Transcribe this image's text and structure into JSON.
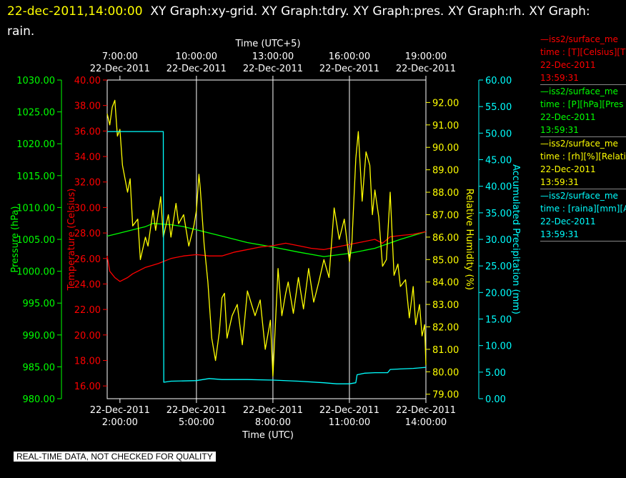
{
  "header": {
    "timestamp": "22-dec-2011,14:00:00",
    "titles": "XY Graph:xy-grid.  XY Graph:tdry.  XY Graph:pres.  XY Graph:rh.  XY Graph: rain."
  },
  "footer": {
    "quality_notice": "REAL-TIME DATA, NOT CHECKED FOR QUALITY"
  },
  "colors": {
    "background": "#000000",
    "frame": "#ffffff",
    "pressure": "#00ff00",
    "temperature": "#ff0000",
    "humidity": "#ffff00",
    "precip": "#00ffff"
  },
  "legend": [
    {
      "color": "#ff0000",
      "line1": "—iss2/surface_me",
      "line2": "time : [T][Celsius][T",
      "date": "22-Dec-2011",
      "time": "13:59:31"
    },
    {
      "color": "#00ff00",
      "line1": "—iss2/surface_me",
      "line2": "time : [P][hPa][Pres",
      "date": "22-Dec-2011",
      "time": "13:59:31"
    },
    {
      "color": "#ffff00",
      "line1": "—iss2/surface_me",
      "line2": "time : [rh][%][Relati",
      "date": "22-Dec-2011",
      "time": "13:59:31"
    },
    {
      "color": "#00ffff",
      "line1": "—iss2/surface_me",
      "line2": "time : [raina][mm][A",
      "date": "22-Dec-2011",
      "time": "13:59:31"
    }
  ],
  "chart_data": {
    "type": "line",
    "xlabel_top": "Time (UTC+5)",
    "xlabel_bottom": "Time (UTC)",
    "x_range_hours_utc": [
      1.5,
      14.0
    ],
    "x_ticks_bottom": [
      {
        "hour": 2,
        "date": "22-Dec-2011",
        "time": "2:00:00"
      },
      {
        "hour": 5,
        "date": "22-Dec-2011",
        "time": "5:00:00"
      },
      {
        "hour": 8,
        "date": "22-Dec-2011",
        "time": "8:00:00"
      },
      {
        "hour": 11,
        "date": "22-Dec-2011",
        "time": "11:00:00"
      },
      {
        "hour": 14,
        "date": "22-Dec-2011",
        "time": "14:00:00"
      }
    ],
    "x_ticks_top": [
      {
        "hour": 2,
        "time": "7:00:00",
        "date": "22-Dec-2011"
      },
      {
        "hour": 5,
        "time": "10:00:00",
        "date": "22-Dec-2011"
      },
      {
        "hour": 8,
        "time": "13:00:00",
        "date": "22-Dec-2011"
      },
      {
        "hour": 11,
        "time": "16:00:00",
        "date": "22-Dec-2011"
      },
      {
        "hour": 14,
        "time": "19:00:00",
        "date": "22-Dec-2011"
      }
    ],
    "grid_vertical_hours": [
      5,
      8,
      11
    ],
    "axes": {
      "pressure": {
        "label": "Pressure (hPa)",
        "range": [
          980,
          1030
        ],
        "ticks": [
          "980.00",
          "985.00",
          "990.00",
          "995.00",
          "1000.00",
          "1005.00",
          "1010.00",
          "1015.00",
          "1020.00",
          "1025.00",
          "1030.00"
        ]
      },
      "temperature": {
        "label": "Temperature (Celsius)",
        "range": [
          15,
          40
        ],
        "ticks": [
          "16.00",
          "18.00",
          "20.00",
          "22.00",
          "24.00",
          "26.00",
          "28.00",
          "30.00",
          "32.00",
          "34.00",
          "36.00",
          "38.00",
          "40.00"
        ]
      },
      "humidity": {
        "label": "Relative Humidity (%)",
        "range": [
          78.8,
          93.0
        ],
        "ticks": [
          "79.00",
          "80.00",
          "81.00",
          "82.00",
          "83.00",
          "84.00",
          "85.00",
          "86.00",
          "87.00",
          "88.00",
          "89.00",
          "90.00",
          "91.00",
          "92.00"
        ]
      },
      "precip": {
        "label": "Accumulated Precipitation (mm)",
        "range": [
          0,
          60
        ],
        "ticks": [
          "0.00",
          "5.00",
          "10.00",
          "15.00",
          "20.00",
          "25.00",
          "30.00",
          "35.00",
          "40.00",
          "45.00",
          "50.00",
          "55.00",
          "60.00"
        ]
      }
    },
    "series": [
      {
        "key": "pressure",
        "axis": "pressure",
        "x": [
          1.5,
          2.0,
          2.5,
          3.0,
          3.3,
          4.0,
          4.5,
          5.0,
          6.0,
          7.0,
          8.0,
          9.0,
          10.0,
          11.0,
          12.0,
          13.0,
          14.0
        ],
        "y": [
          1005.5,
          1006.0,
          1006.5,
          1007.0,
          1007.5,
          1007.3,
          1007.0,
          1006.5,
          1005.5,
          1004.5,
          1003.8,
          1003.0,
          1002.3,
          1002.8,
          1003.6,
          1005.0,
          1006.2
        ]
      },
      {
        "key": "temperature",
        "axis": "temperature",
        "x": [
          1.5,
          1.6,
          1.8,
          2.0,
          2.3,
          2.5,
          3.0,
          3.5,
          4.0,
          4.5,
          5.0,
          5.5,
          6.0,
          6.5,
          7.0,
          7.5,
          8.0,
          8.5,
          9.0,
          9.5,
          10.0,
          10.5,
          11.0,
          11.5,
          12.0,
          12.3,
          12.6,
          13.0,
          13.5,
          14.0
        ],
        "y": [
          26.2,
          25.0,
          24.5,
          24.2,
          24.5,
          24.8,
          25.3,
          25.6,
          26.0,
          26.2,
          26.3,
          26.2,
          26.2,
          26.5,
          26.7,
          26.9,
          27.0,
          27.2,
          27.0,
          26.8,
          26.7,
          26.9,
          27.1,
          27.3,
          27.5,
          27.2,
          27.7,
          27.8,
          27.9,
          28.1
        ]
      },
      {
        "key": "humidity",
        "axis": "humidity",
        "x": [
          1.5,
          1.6,
          1.7,
          1.8,
          1.9,
          2.0,
          2.1,
          2.3,
          2.4,
          2.5,
          2.7,
          2.8,
          3.0,
          3.1,
          3.3,
          3.4,
          3.6,
          3.7,
          3.9,
          4.0,
          4.2,
          4.3,
          4.5,
          4.7,
          4.9,
          5.0,
          5.1,
          5.15,
          5.3,
          5.45,
          5.6,
          5.75,
          5.9,
          6.0,
          6.1,
          6.2,
          6.4,
          6.6,
          6.8,
          7.0,
          7.3,
          7.5,
          7.7,
          7.9,
          8.0,
          8.2,
          8.35,
          8.5,
          8.6,
          8.8,
          9.0,
          9.2,
          9.4,
          9.6,
          9.8,
          10.0,
          10.2,
          10.4,
          10.6,
          10.8,
          11.0,
          11.1,
          11.25,
          11.35,
          11.5,
          11.65,
          11.8,
          11.9,
          12.0,
          12.15,
          12.3,
          12.45,
          12.6,
          12.75,
          12.9,
          13.0,
          13.2,
          13.35,
          13.5,
          13.6,
          13.75,
          13.85,
          13.95,
          14.0
        ],
        "y": [
          91.5,
          91.0,
          91.8,
          92.1,
          90.5,
          90.8,
          89.2,
          88.0,
          88.6,
          86.5,
          86.8,
          85.0,
          86.0,
          85.6,
          87.2,
          86.3,
          87.8,
          86.0,
          87.0,
          86.0,
          87.5,
          86.6,
          87.0,
          85.6,
          86.5,
          87.2,
          88.8,
          88.2,
          85.7,
          84.0,
          81.5,
          80.5,
          81.8,
          83.3,
          83.5,
          81.5,
          82.5,
          83.0,
          81.2,
          83.6,
          82.5,
          83.2,
          81.0,
          82.3,
          79.8,
          84.6,
          82.5,
          83.5,
          84.0,
          82.6,
          84.2,
          82.8,
          84.6,
          83.1,
          84.0,
          85.0,
          84.2,
          87.3,
          85.9,
          86.8,
          84.9,
          85.8,
          89.5,
          90.7,
          87.6,
          89.8,
          89.2,
          87.0,
          88.1,
          86.9,
          84.7,
          85.0,
          88.0,
          84.3,
          84.8,
          83.8,
          84.1,
          82.4,
          83.8,
          82.1,
          83.0,
          81.6,
          82.1,
          80.3
        ]
      },
      {
        "key": "precip",
        "axis": "precip",
        "x": [
          1.5,
          3.7,
          3.72,
          4.0,
          5.0,
          5.5,
          6.0,
          7.0,
          8.0,
          9.0,
          10.0,
          10.5,
          11.0,
          11.25,
          11.3,
          11.6,
          12.0,
          12.5,
          12.6,
          13.0,
          13.5,
          14.0
        ],
        "y": [
          50.3,
          50.3,
          3.1,
          3.3,
          3.4,
          3.8,
          3.6,
          3.6,
          3.5,
          3.3,
          3.0,
          2.8,
          2.8,
          3.0,
          4.5,
          4.8,
          4.9,
          4.9,
          5.5,
          5.6,
          5.7,
          5.9
        ]
      }
    ]
  }
}
